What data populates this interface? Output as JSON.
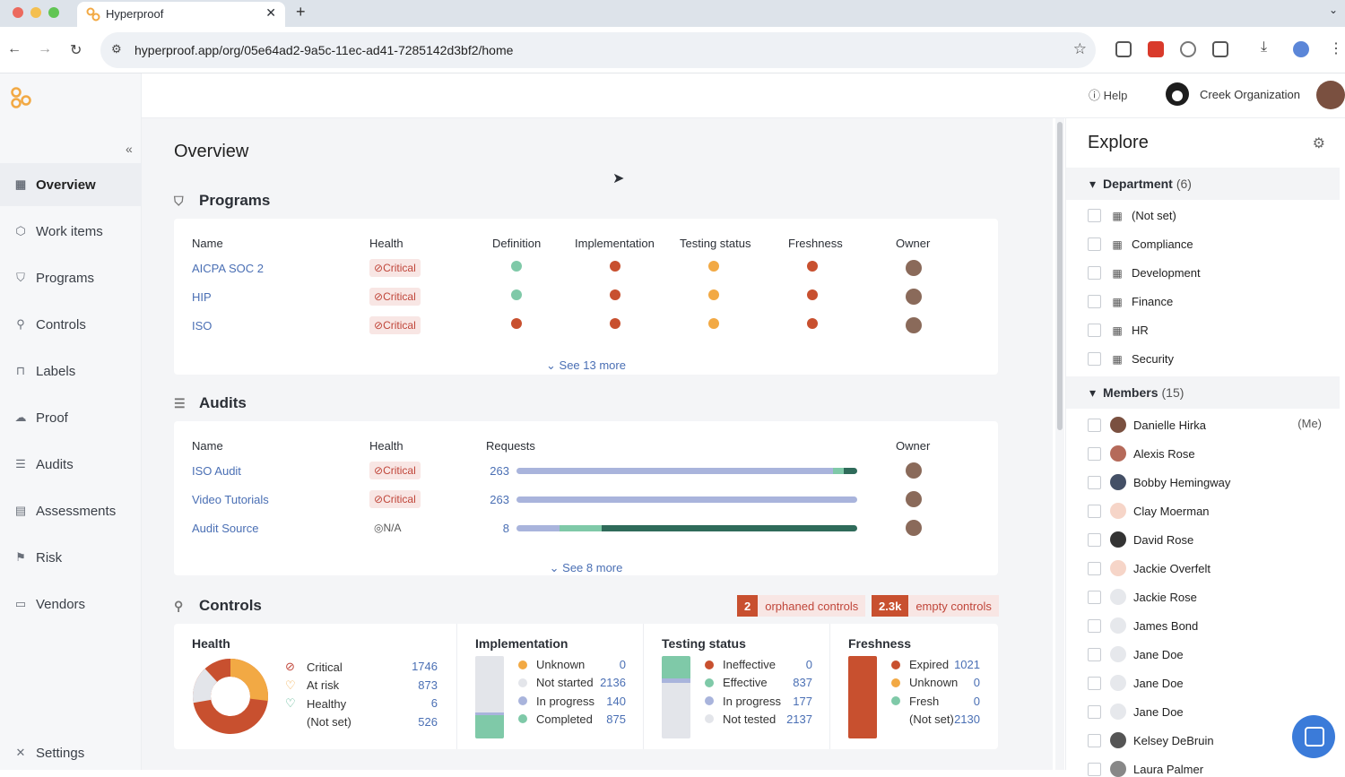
{
  "browser": {
    "tab_title": "Hyperproof",
    "url": "hyperproof.app/org/05e64ad2-9a5c-11ec-ad41-7285142d3bf2/home"
  },
  "sidebar": {
    "items": [
      {
        "label": "Overview",
        "icon": "grid-icon",
        "active": true
      },
      {
        "label": "Work items",
        "icon": "box-icon"
      },
      {
        "label": "Programs",
        "icon": "shield-icon"
      },
      {
        "label": "Controls",
        "icon": "controls-icon"
      },
      {
        "label": "Labels",
        "icon": "bookmark-icon"
      },
      {
        "label": "Proof",
        "icon": "cloud-icon"
      },
      {
        "label": "Audits",
        "icon": "audit-icon"
      },
      {
        "label": "Assessments",
        "icon": "clipboard-icon"
      },
      {
        "label": "Risk",
        "icon": "flag-icon"
      },
      {
        "label": "Vendors",
        "icon": "vendor-icon"
      }
    ],
    "settings_label": "Settings"
  },
  "topbar": {
    "help_label": "Help",
    "org_name": "Creek Organization"
  },
  "overview": {
    "title": "Overview",
    "programs": {
      "title": "Programs",
      "columns": [
        "Name",
        "Health",
        "Definition",
        "Implementation",
        "Testing status",
        "Freshness",
        "Owner"
      ],
      "rows": [
        {
          "name": "AICPA SOC 2",
          "health": "Critical",
          "dots": [
            "#7fc9a8",
            "#c8502f",
            "#f2a944",
            "#c8502f"
          ]
        },
        {
          "name": "HIP",
          "health": "Critical",
          "dots": [
            "#7fc9a8",
            "#c8502f",
            "#f2a944",
            "#c8502f"
          ]
        },
        {
          "name": "ISO",
          "health": "Critical",
          "dots": [
            "#c8502f",
            "#c8502f",
            "#f2a944",
            "#c8502f"
          ]
        }
      ],
      "see_more": "See 13 more"
    },
    "audits": {
      "title": "Audits",
      "columns": [
        "Name",
        "Health",
        "Requests",
        "Owner"
      ],
      "rows": [
        {
          "name": "ISO Audit",
          "health": "Critical",
          "requests": "263",
          "segments": [
            {
              "frac": 0.93,
              "color": "#a9b4dc"
            },
            {
              "frac": 0.03,
              "color": "#7fc9a8"
            },
            {
              "frac": 0.04,
              "color": "#2f6b5a"
            }
          ]
        },
        {
          "name": "Video Tutorials",
          "health": "Critical",
          "requests": "263",
          "segments": [
            {
              "frac": 1.0,
              "color": "#a9b4dc"
            }
          ]
        },
        {
          "name": "Audit Source",
          "health": "N/A",
          "requests": "8",
          "segments": [
            {
              "frac": 0.125,
              "color": "#a9b4dc"
            },
            {
              "frac": 0.125,
              "color": "#7fc9a8"
            },
            {
              "frac": 0.75,
              "color": "#2f6b5a"
            }
          ]
        }
      ],
      "see_more": "See 8 more"
    },
    "controls": {
      "title": "Controls",
      "orphaned_count": "2",
      "orphaned_label": "orphaned controls",
      "empty_count": "2.3k",
      "empty_label": "empty controls",
      "health": {
        "title": "Health",
        "items": [
          {
            "label": "Critical",
            "value": "1746"
          },
          {
            "label": "At risk",
            "value": "873"
          },
          {
            "label": "Healthy",
            "value": "6"
          },
          {
            "label": "(Not set)",
            "value": "526"
          }
        ]
      },
      "implementation": {
        "title": "Implementation",
        "items": [
          {
            "label": "Unknown",
            "value": "0",
            "color": "#f2a944"
          },
          {
            "label": "Not started",
            "value": "2136",
            "color": "#e3e5ea"
          },
          {
            "label": "In progress",
            "value": "140",
            "color": "#a9b4dc"
          },
          {
            "label": "Completed",
            "value": "875",
            "color": "#7fc9a8"
          }
        ]
      },
      "testing": {
        "title": "Testing status",
        "items": [
          {
            "label": "Ineffective",
            "value": "0",
            "color": "#c8502f"
          },
          {
            "label": "Effective",
            "value": "837",
            "color": "#7fc9a8"
          },
          {
            "label": "In progress",
            "value": "177",
            "color": "#a9b4dc"
          },
          {
            "label": "Not tested",
            "value": "2137",
            "color": "#e3e5ea"
          }
        ]
      },
      "freshness": {
        "title": "Freshness",
        "items": [
          {
            "label": "Expired",
            "value": "1021",
            "color": "#c8502f"
          },
          {
            "label": "Unknown",
            "value": "0",
            "color": "#f2a944"
          },
          {
            "label": "Fresh",
            "value": "0",
            "color": "#7fc9a8"
          },
          {
            "label": "(Not set)",
            "value": "2130",
            "color": ""
          }
        ]
      }
    }
  },
  "explore": {
    "title": "Explore",
    "department": {
      "label": "Department",
      "count": "(6)",
      "items": [
        "(Not set)",
        "Compliance",
        "Development",
        "Finance",
        "HR",
        "Security"
      ]
    },
    "members": {
      "label": "Members",
      "count": "(15)",
      "me_label": "(Me)",
      "items": [
        "Danielle Hirka",
        "Alexis Rose",
        "Bobby Hemingway",
        "Clay Moerman",
        "David Rose",
        "Jackie Overfelt",
        "Jackie Rose",
        "James Bond",
        "Jane Doe",
        "Jane Doe",
        "Jane Doe",
        "Kelsey DeBruin",
        "Laura Palmer"
      ]
    }
  }
}
